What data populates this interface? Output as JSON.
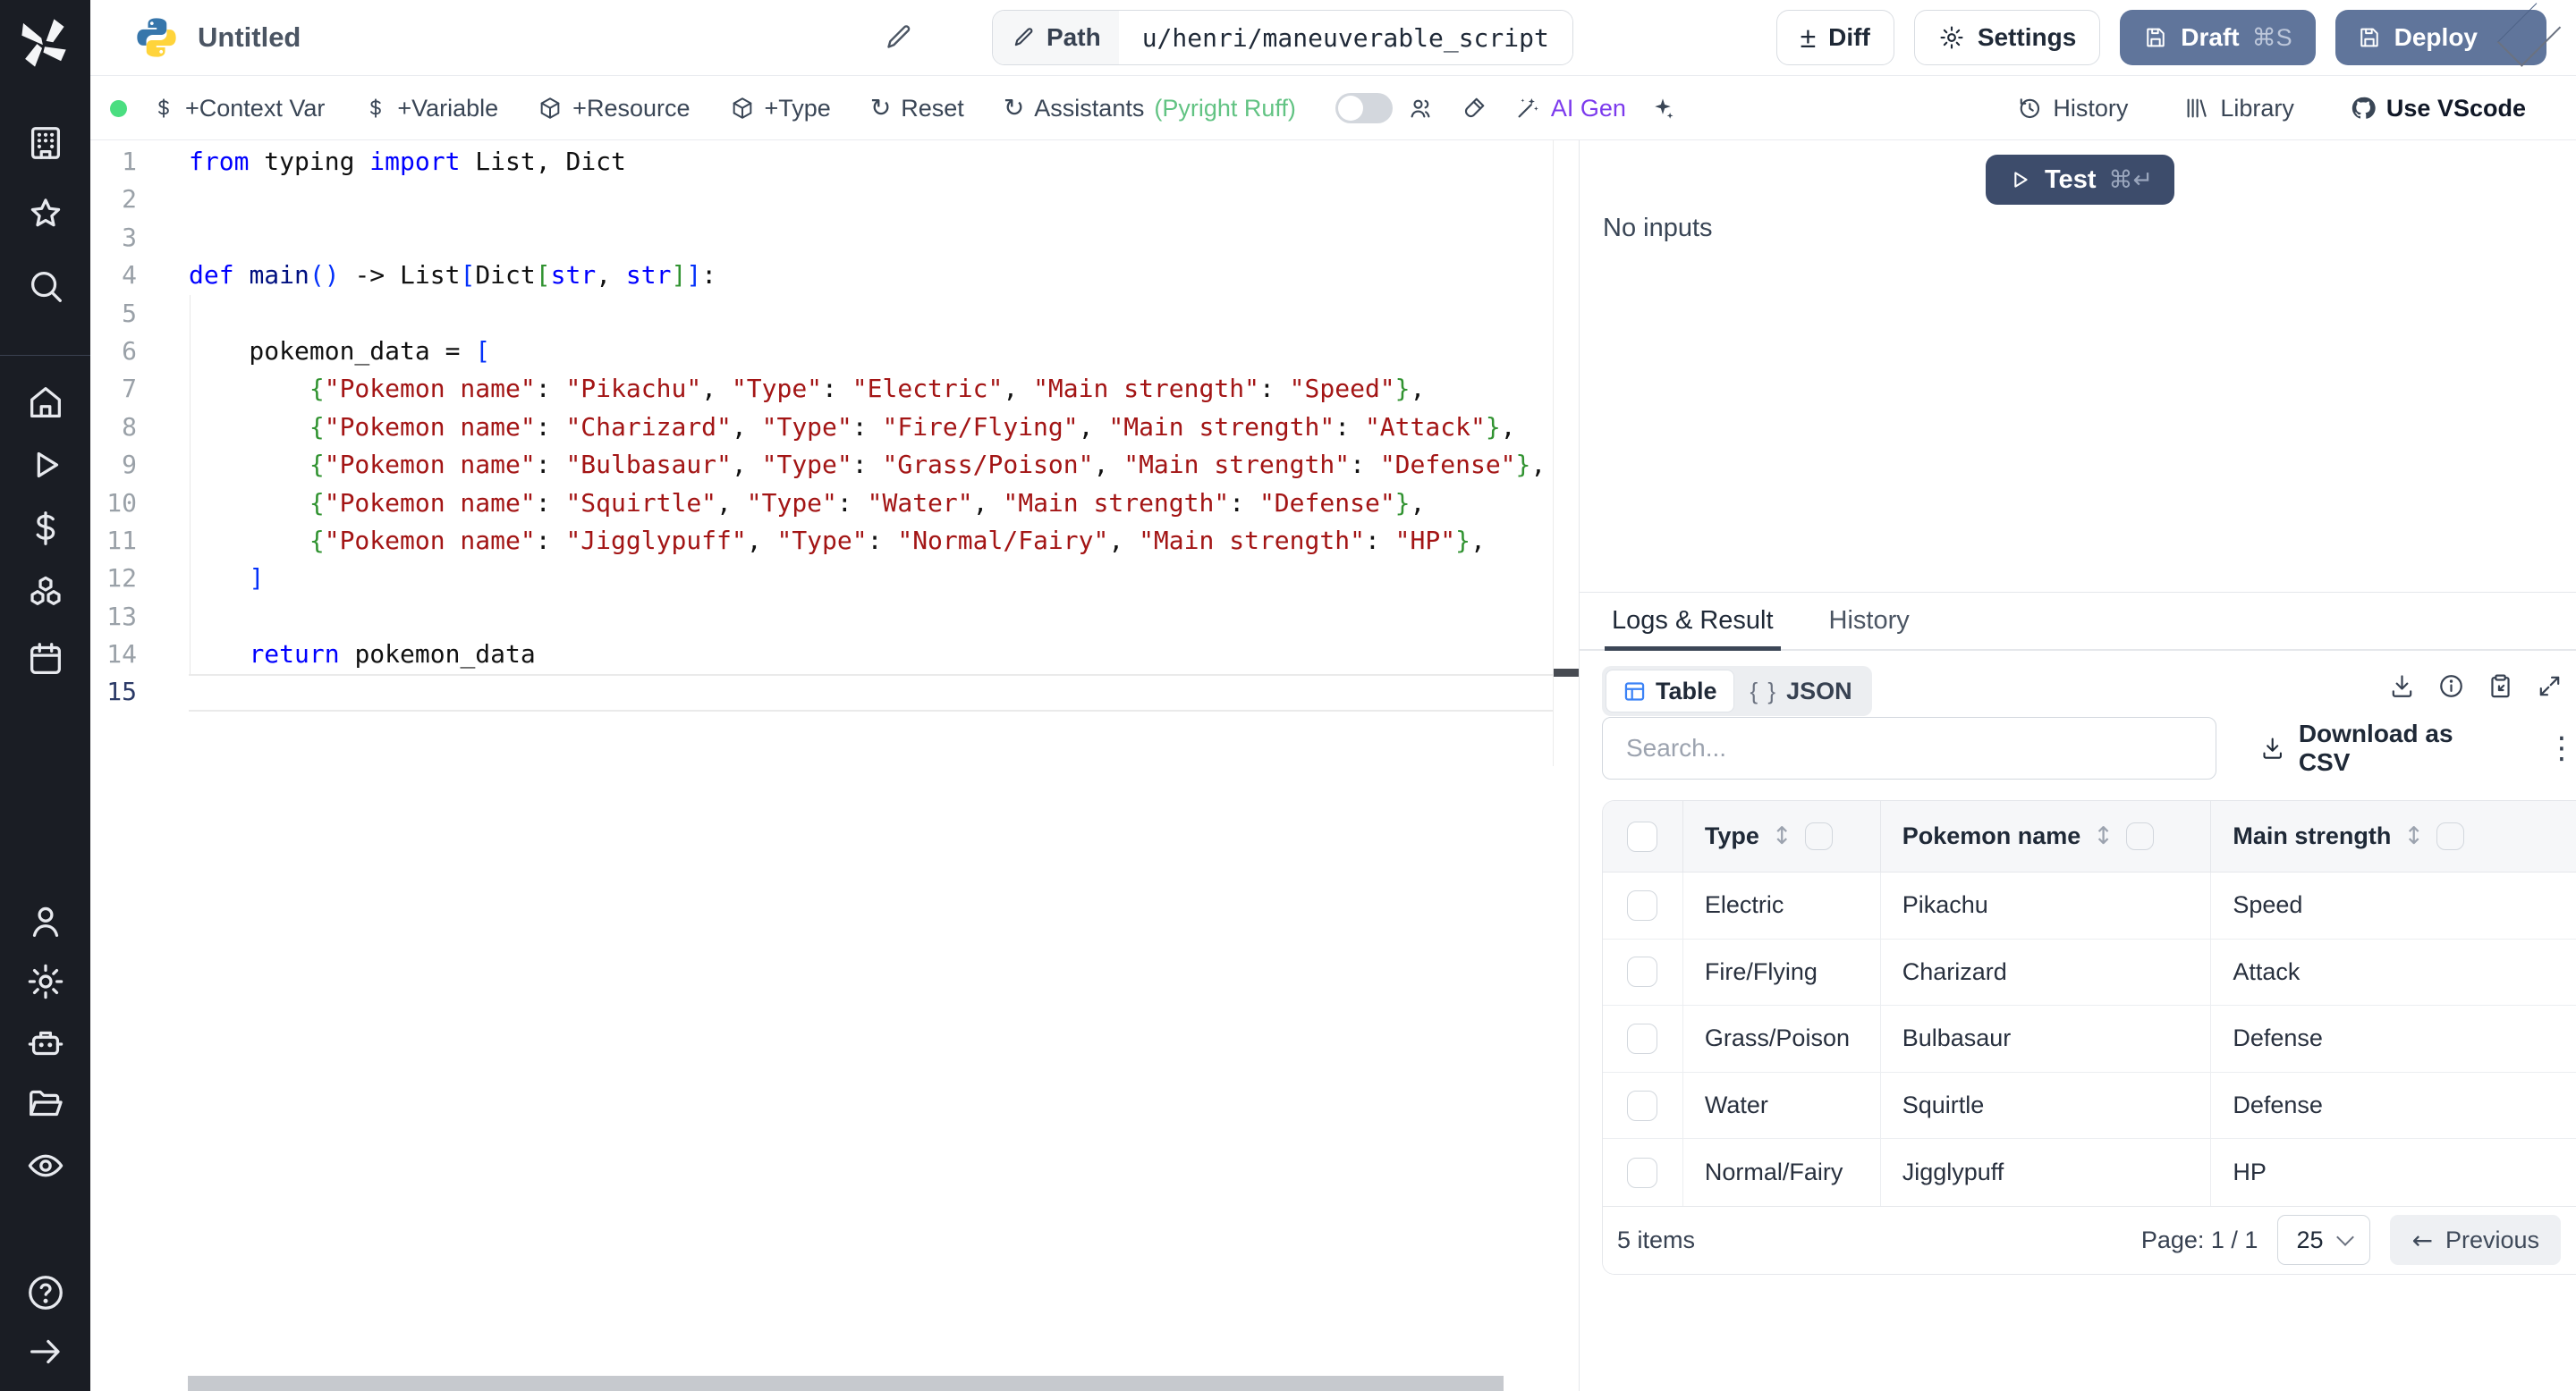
{
  "sidebar": {
    "logo_icon": "windmill-logo",
    "icons_top": [
      "building-icon",
      "star-icon",
      "search-icon"
    ],
    "icons_mid": [
      "home-icon",
      "play-icon",
      "dollar-icon",
      "cubes-icon",
      "calendar-icon"
    ],
    "icons_lower": [
      "user-icon",
      "gear-icon",
      "robot-icon",
      "folder-icon",
      "eye-icon"
    ],
    "icons_bottom": [
      "help-icon",
      "arrow-right-icon"
    ]
  },
  "topbar": {
    "language_icon": "python-logo",
    "title": "Untitled",
    "path_label": "Path",
    "path_value": "u/henri/maneuverable_script",
    "diff_label": "Diff",
    "settings_label": "Settings",
    "draft_label": "Draft",
    "draft_shortcut": "⌘S",
    "deploy_label": "Deploy"
  },
  "toolbar": {
    "status_dot_color": "#4ade80",
    "add_context_var": "+Context Var",
    "add_variable": "+Variable",
    "add_resource": "+Resource",
    "add_type": "+Type",
    "reset": "Reset",
    "assistants": "Assistants",
    "assistants_detail": "(Pyright Ruff)",
    "assistants_detail_color": "#62c383",
    "ai_gen": "AI Gen",
    "ai_gen_color": "#7c3aed",
    "history": "History",
    "library": "Library",
    "use_vscode": "Use VScode"
  },
  "editor": {
    "active_line": 15,
    "lines": [
      [
        [
          "from",
          "kw"
        ],
        [
          " typing ",
          ""
        ],
        [
          "import",
          "kw"
        ],
        [
          " List, Dict",
          ""
        ]
      ],
      [],
      [],
      [
        [
          "def",
          "kw"
        ],
        [
          " ",
          ""
        ],
        [
          "main",
          "fn"
        ],
        [
          "(",
          "b1"
        ],
        [
          ")",
          "b1"
        ],
        [
          " -> List",
          ""
        ],
        [
          "[",
          "b1"
        ],
        [
          "Dict",
          ""
        ],
        [
          "[",
          "b2"
        ],
        [
          "str",
          "kw"
        ],
        [
          ", ",
          ""
        ],
        [
          "str",
          "kw"
        ],
        [
          "]",
          "b2"
        ],
        [
          "]",
          "b1"
        ],
        [
          ":",
          ""
        ]
      ],
      [],
      [
        [
          "    pokemon_data = ",
          ""
        ],
        [
          "[",
          "b1"
        ]
      ],
      [
        [
          "        ",
          ""
        ],
        [
          "{",
          "b2"
        ],
        [
          "\"Pokemon name\"",
          "str"
        ],
        [
          ": ",
          ""
        ],
        [
          "\"Pikachu\"",
          "str"
        ],
        [
          ", ",
          ""
        ],
        [
          "\"Type\"",
          "str"
        ],
        [
          ": ",
          ""
        ],
        [
          "\"Electric\"",
          "str"
        ],
        [
          ", ",
          ""
        ],
        [
          "\"Main strength\"",
          "str"
        ],
        [
          ": ",
          ""
        ],
        [
          "\"Speed\"",
          "str"
        ],
        [
          "}",
          "b2"
        ],
        [
          ",",
          ""
        ]
      ],
      [
        [
          "        ",
          ""
        ],
        [
          "{",
          "b2"
        ],
        [
          "\"Pokemon name\"",
          "str"
        ],
        [
          ": ",
          ""
        ],
        [
          "\"Charizard\"",
          "str"
        ],
        [
          ", ",
          ""
        ],
        [
          "\"Type\"",
          "str"
        ],
        [
          ": ",
          ""
        ],
        [
          "\"Fire/Flying\"",
          "str"
        ],
        [
          ", ",
          ""
        ],
        [
          "\"Main strength\"",
          "str"
        ],
        [
          ": ",
          ""
        ],
        [
          "\"Attack\"",
          "str"
        ],
        [
          "}",
          "b2"
        ],
        [
          ",",
          ""
        ]
      ],
      [
        [
          "        ",
          ""
        ],
        [
          "{",
          "b2"
        ],
        [
          "\"Pokemon name\"",
          "str"
        ],
        [
          ": ",
          ""
        ],
        [
          "\"Bulbasaur\"",
          "str"
        ],
        [
          ", ",
          ""
        ],
        [
          "\"Type\"",
          "str"
        ],
        [
          ": ",
          ""
        ],
        [
          "\"Grass/Poison\"",
          "str"
        ],
        [
          ", ",
          ""
        ],
        [
          "\"Main strength\"",
          "str"
        ],
        [
          ": ",
          ""
        ],
        [
          "\"Defense\"",
          "str"
        ],
        [
          "}",
          "b2"
        ],
        [
          ",",
          ""
        ]
      ],
      [
        [
          "        ",
          ""
        ],
        [
          "{",
          "b2"
        ],
        [
          "\"Pokemon name\"",
          "str"
        ],
        [
          ": ",
          ""
        ],
        [
          "\"Squirtle\"",
          "str"
        ],
        [
          ", ",
          ""
        ],
        [
          "\"Type\"",
          "str"
        ],
        [
          ": ",
          ""
        ],
        [
          "\"Water\"",
          "str"
        ],
        [
          ", ",
          ""
        ],
        [
          "\"Main strength\"",
          "str"
        ],
        [
          ": ",
          ""
        ],
        [
          "\"Defense\"",
          "str"
        ],
        [
          "}",
          "b2"
        ],
        [
          ",",
          ""
        ]
      ],
      [
        [
          "        ",
          ""
        ],
        [
          "{",
          "b2"
        ],
        [
          "\"Pokemon name\"",
          "str"
        ],
        [
          ": ",
          ""
        ],
        [
          "\"Jigglypuff\"",
          "str"
        ],
        [
          ", ",
          ""
        ],
        [
          "\"Type\"",
          "str"
        ],
        [
          ": ",
          ""
        ],
        [
          "\"Normal/Fairy\"",
          "str"
        ],
        [
          ", ",
          ""
        ],
        [
          "\"Main strength\"",
          "str"
        ],
        [
          ": ",
          ""
        ],
        [
          "\"HP\"",
          "str"
        ],
        [
          "}",
          "b2"
        ],
        [
          ",",
          ""
        ]
      ],
      [
        [
          "    ",
          ""
        ],
        [
          "]",
          "b1"
        ]
      ],
      [],
      [
        [
          "    ",
          ""
        ],
        [
          "return",
          "kw"
        ],
        [
          " pokemon_data",
          ""
        ]
      ],
      []
    ]
  },
  "run_panel": {
    "test_label": "Test",
    "test_shortcut": "⌘↵",
    "no_inputs": "No inputs"
  },
  "result_panel": {
    "tab_logs": "Logs & Result",
    "tab_history": "History",
    "view_table": "Table",
    "view_json": "JSON",
    "json_braces": "{ }",
    "search_placeholder": "Search...",
    "download_csv": "Download as CSV",
    "table": {
      "columns": [
        "Type",
        "Pokemon name",
        "Main strength"
      ],
      "rows": [
        [
          "Electric",
          "Pikachu",
          "Speed"
        ],
        [
          "Fire/Flying",
          "Charizard",
          "Attack"
        ],
        [
          "Grass/Poison",
          "Bulbasaur",
          "Defense"
        ],
        [
          "Water",
          "Squirtle",
          "Defense"
        ],
        [
          "Normal/Fairy",
          "Jigglypuff",
          "HP"
        ]
      ]
    },
    "footer": {
      "items_count": "5 items",
      "page_label": "Page: 1 / 1",
      "page_size": "25",
      "previous_label": "Previous"
    }
  },
  "colors": {
    "accent_slate": "#60759b",
    "test_navy": "#3d4c6b",
    "status_green": "#4ade80",
    "table_icon_blue": "#3b82f6",
    "code_keyword": "#0000ff",
    "code_string": "#a31515",
    "code_bracket_l1": "#0431fa",
    "code_bracket_l2": "#319331"
  }
}
